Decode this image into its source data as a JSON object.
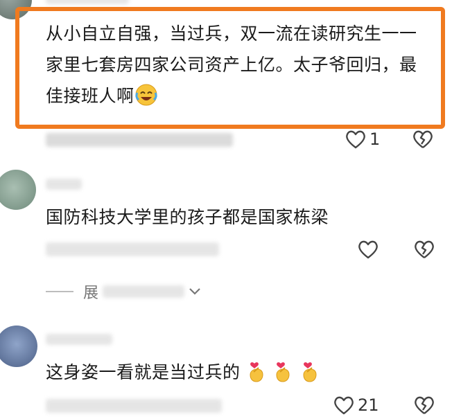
{
  "comments": [
    {
      "text": "从小自立自强，当过兵，双一流在读研究生一一家里七套房四家公司资产上亿。太子爷回归，最佳接班人啊",
      "trailing_emoji": "face-with-tears-of-joy-emoji",
      "like_count": "1"
    },
    {
      "text": "国防科技大学里的孩子都是国家栋梁",
      "like_count": ""
    },
    {
      "text": "这身姿一看就是当过兵的",
      "trailing_emoji": "finger-heart-emoji x3",
      "like_count": "21"
    }
  ],
  "expand_label": "展",
  "colors": {
    "highlight": "#f07a1f",
    "muted": "#777777"
  },
  "icons": [
    "heart-outline-icon",
    "broken-heart-icon",
    "chevron-down-icon"
  ]
}
